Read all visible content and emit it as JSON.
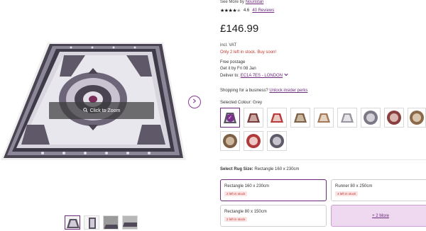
{
  "gallery": {
    "zoom_label": "Click to Zoom",
    "zoom_icon": "magnifier-icon",
    "next_icon": "chevron-right-icon",
    "thumbnail_count": 4
  },
  "product": {
    "see_more_prefix": "See More by",
    "brand": "Nouristan",
    "rating": "4.6",
    "reviews": "40 Reviews",
    "price": "£146.99",
    "vat": "incl. VAT",
    "stock_warning": "Only 2 left in stock. Buy soon!",
    "postage": "Free postage",
    "get_it": "Get it by Fri 08 Jan",
    "deliver_prefix": "Deliver to:",
    "deliver_location": "EC1A 7ES - LONDON",
    "business_prefix": "Shopping for a business?",
    "business_link": "Unlock insider perks"
  },
  "colour": {
    "label_prefix": "Selected Colour:",
    "selected": "Grey"
  },
  "size": {
    "label_prefix": "Select Rug Size:",
    "selected": "Rectangle 160 x 230cm",
    "options": [
      {
        "name": "Rectangle 160 x 230cm",
        "stock": "2 left in stock"
      },
      {
        "name": "Runner 80 x 250cm",
        "stock": "4 left in stock"
      },
      {
        "name": "Rectangle 80 x 150cm",
        "stock": "2 left in stock"
      }
    ],
    "more": "+ 2 More"
  },
  "colors": {
    "accent": "#6b2a7a",
    "stock_red": "#c0392b",
    "more_bg": "#efd9f1"
  }
}
